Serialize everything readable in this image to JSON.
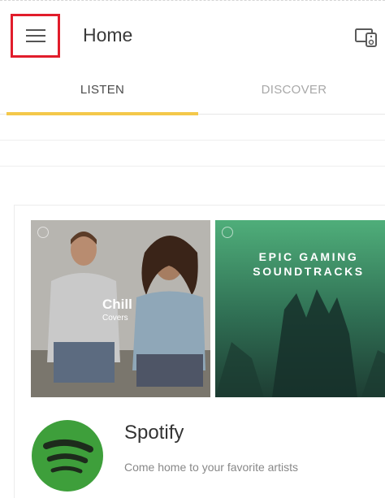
{
  "app_bar": {
    "title": "Home",
    "menu_icon": "hamburger-menu-icon",
    "cast_icon": "cast-device-icon",
    "highlight_color": "#e11d2b"
  },
  "tabs": [
    {
      "label": "LISTEN",
      "selected": true
    },
    {
      "label": "DISCOVER",
      "selected": false
    }
  ],
  "tab_indicator_color": "#f4c84a",
  "playlists": [
    {
      "title": "Chill",
      "subtitle": "Covers"
    },
    {
      "title": "EPIC GAMING SOUNDTRACKS"
    }
  ],
  "service": {
    "name": "Spotify",
    "description": "Come home to your favorite artists",
    "brand_color": "#3e9f3b"
  }
}
